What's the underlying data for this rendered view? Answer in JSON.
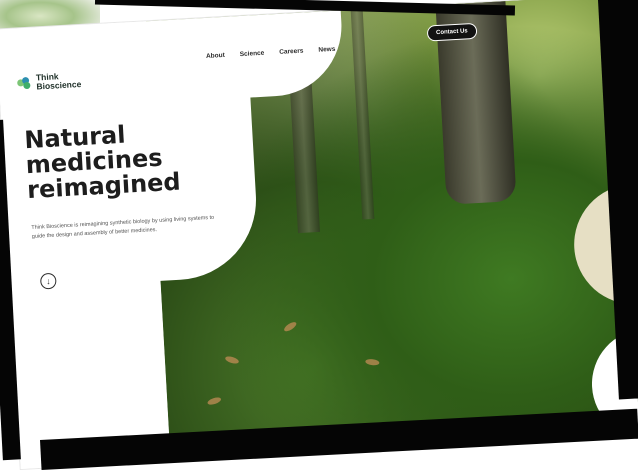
{
  "header": {
    "logo": {
      "line1": "Think",
      "line2": "Bioscience",
      "colors": [
        "#3fae6b",
        "#2c8fb0",
        "#7cc576"
      ]
    },
    "nav": [
      "About",
      "Science",
      "Careers",
      "News"
    ],
    "contact_label": "Contact Us"
  },
  "hero": {
    "headline": "Natural medicines reimagined",
    "tagline": "Think Bioscience is reimagining synthetic biology by using living systems to guide the design and assembly of better medicines.",
    "scroll_icon": "arrow-down-circle-icon"
  },
  "colors": {
    "accent_beige": "#e6dfc4",
    "button_dark": "#121212",
    "text_dark": "#1d1d1d"
  }
}
